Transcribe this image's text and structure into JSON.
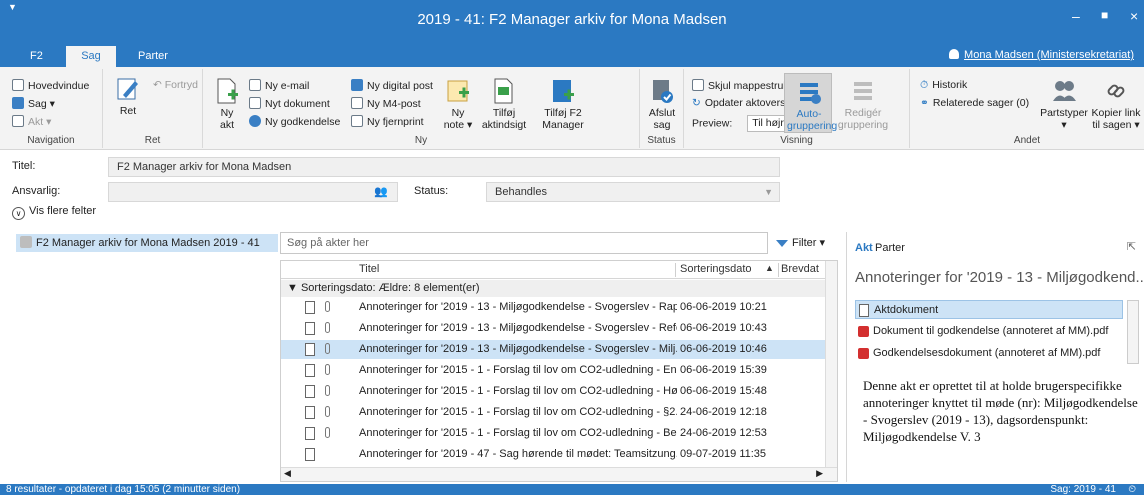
{
  "window": {
    "title": "2019 - 41: F2 Manager arkiv for Mona Madsen",
    "controls": [
      "minimize-icon",
      "maximize-icon",
      "close-icon"
    ]
  },
  "tabs": [
    {
      "label": "F2"
    },
    {
      "label": "Sag",
      "active": true
    },
    {
      "label": "Parter"
    }
  ],
  "user": {
    "label": "Mona Madsen (Ministersekretariat)"
  },
  "ribbon": {
    "navigation": {
      "label": "Navigation",
      "hovedvindue": "Hovedvindue",
      "sag": "Sag ▾",
      "akt": "Akt ▾"
    },
    "ret": {
      "label": "Ret",
      "ret_btn": "Ret",
      "fortryd": "Fortryd"
    },
    "ny": {
      "label": "Ny",
      "ny_akt_line1": "Ny",
      "ny_akt_line2": "akt",
      "ny_email": "Ny e-mail",
      "nyt_dokument": "Nyt dokument",
      "ny_godkendelse": "Ny godkendelse",
      "ny_digital_post": "Ny digital post",
      "ny_m4_post": "Ny M4-post",
      "ny_fjernprint": "Ny fjernprint",
      "ny_note_line1": "Ny",
      "ny_note_line2": "note ▾",
      "tilfoj_aktindsigt_line1": "Tilføj",
      "tilfoj_aktindsigt_line2": "aktindsigt",
      "tilfoj_f2_line1": "Tilføj F2",
      "tilfoj_f2_line2": "Manager"
    },
    "status": {
      "label": "Status",
      "afslut_line1": "Afslut",
      "afslut_line2": "sag"
    },
    "visning": {
      "label": "Visning",
      "skjul_mappestruktur": "Skjul mappestruktur",
      "opdater_aktoversigt": "Opdater aktoversigt",
      "preview_label": "Preview:",
      "preview_value": "Til højre",
      "autogruppering_line1": "Auto-",
      "autogruppering_line2": "gruppering",
      "rediger_line1": "Redigér",
      "rediger_line2": "gruppering"
    },
    "andet": {
      "label": "Andet",
      "historik": "Historik",
      "relaterede": "Relaterede sager (0)",
      "partstyper_line1": "Partstyper",
      "partstyper_line2": "▾",
      "kopier_line1": "Kopier link",
      "kopier_line2": "til sagen ▾"
    }
  },
  "fields": {
    "titel_label": "Titel:",
    "titel_value": "F2 Manager arkiv for Mona Madsen",
    "ansvarlig_label": "Ansvarlig:",
    "ansvarlig_value": "",
    "status_label": "Status:",
    "status_value": "Behandles",
    "more_fields": "Vis flere felter"
  },
  "tree": {
    "item": "F2 Manager arkiv for Mona Madsen 2019 - 41"
  },
  "list": {
    "search_placeholder": "Søg på akter her",
    "filter_label": "Filter ▾",
    "col_titel": "Titel",
    "col_sorteringsdato": "Sorteringsdato",
    "col_brevdato": "Brevdat",
    "group_label": "Sorteringsdato: Ældre: 8 element(er)",
    "rows": [
      {
        "title": "Annoteringer for '2019 - 13 - Miljøgodkendelse - Svogerslev - Rap...",
        "date": "06-06-2019 10:21",
        "clip": true,
        "selected": false
      },
      {
        "title": "Annoteringer for '2019 - 13 - Miljøgodkendelse - Svogerslev - Refe...",
        "date": "06-06-2019 10:43",
        "clip": true,
        "selected": false
      },
      {
        "title": "Annoteringer for '2019 - 13 - Miljøgodkendelse - Svogerslev - Milj...",
        "date": "06-06-2019 10:46",
        "clip": true,
        "selected": true
      },
      {
        "title": "Annoteringer for '2015 - 1 - Forslag til lov om CO2-udledning - En...",
        "date": "06-06-2019 15:39",
        "clip": true,
        "selected": false
      },
      {
        "title": "Annoteringer for '2015 - 1 - Forslag til lov om CO2-udledning - Hø...",
        "date": "06-06-2019 15:48",
        "clip": true,
        "selected": false
      },
      {
        "title": "Annoteringer for '2015 - 1 - Forslag til lov om CO2-udledning - §2...",
        "date": "24-06-2019 12:18",
        "clip": true,
        "selected": false
      },
      {
        "title": "Annoteringer for '2015 - 1 - Forslag til lov om CO2-udledning - Be...",
        "date": "24-06-2019 12:53",
        "clip": true,
        "selected": false
      },
      {
        "title": "Annoteringer for '2019 - 47 - Sag hørende til mødet: Teamsitzung...",
        "date": "09-07-2019 11:35",
        "clip": false,
        "selected": false
      }
    ]
  },
  "preview": {
    "tab_akt": "Akt",
    "tab_parter": "Parter",
    "title": "Annoteringer for '2019 - 13 - Miljøgodkend...",
    "attachments": [
      {
        "label": "Aktdokument",
        "type": "doc",
        "selected": true
      },
      {
        "label": "Dokument til godkendelse (annoteret af MM).pdf",
        "type": "pdf",
        "selected": false
      },
      {
        "label": "Godkendelsesdokument (annoteret af MM).pdf",
        "type": "pdf",
        "selected": false
      }
    ],
    "description": "Denne akt er oprettet til at holde brugerspecifikke annoteringer knyttet til møde (nr): Miljøgodkendelse - Svogerslev (2019 - 13), dagsordenspunkt: Miljøgodkendelse V. 3"
  },
  "statusbar": {
    "left": "8 resultater - opdateret i dag 15:05 (2 minutter siden)",
    "right": "Sag: 2019 - 41"
  }
}
